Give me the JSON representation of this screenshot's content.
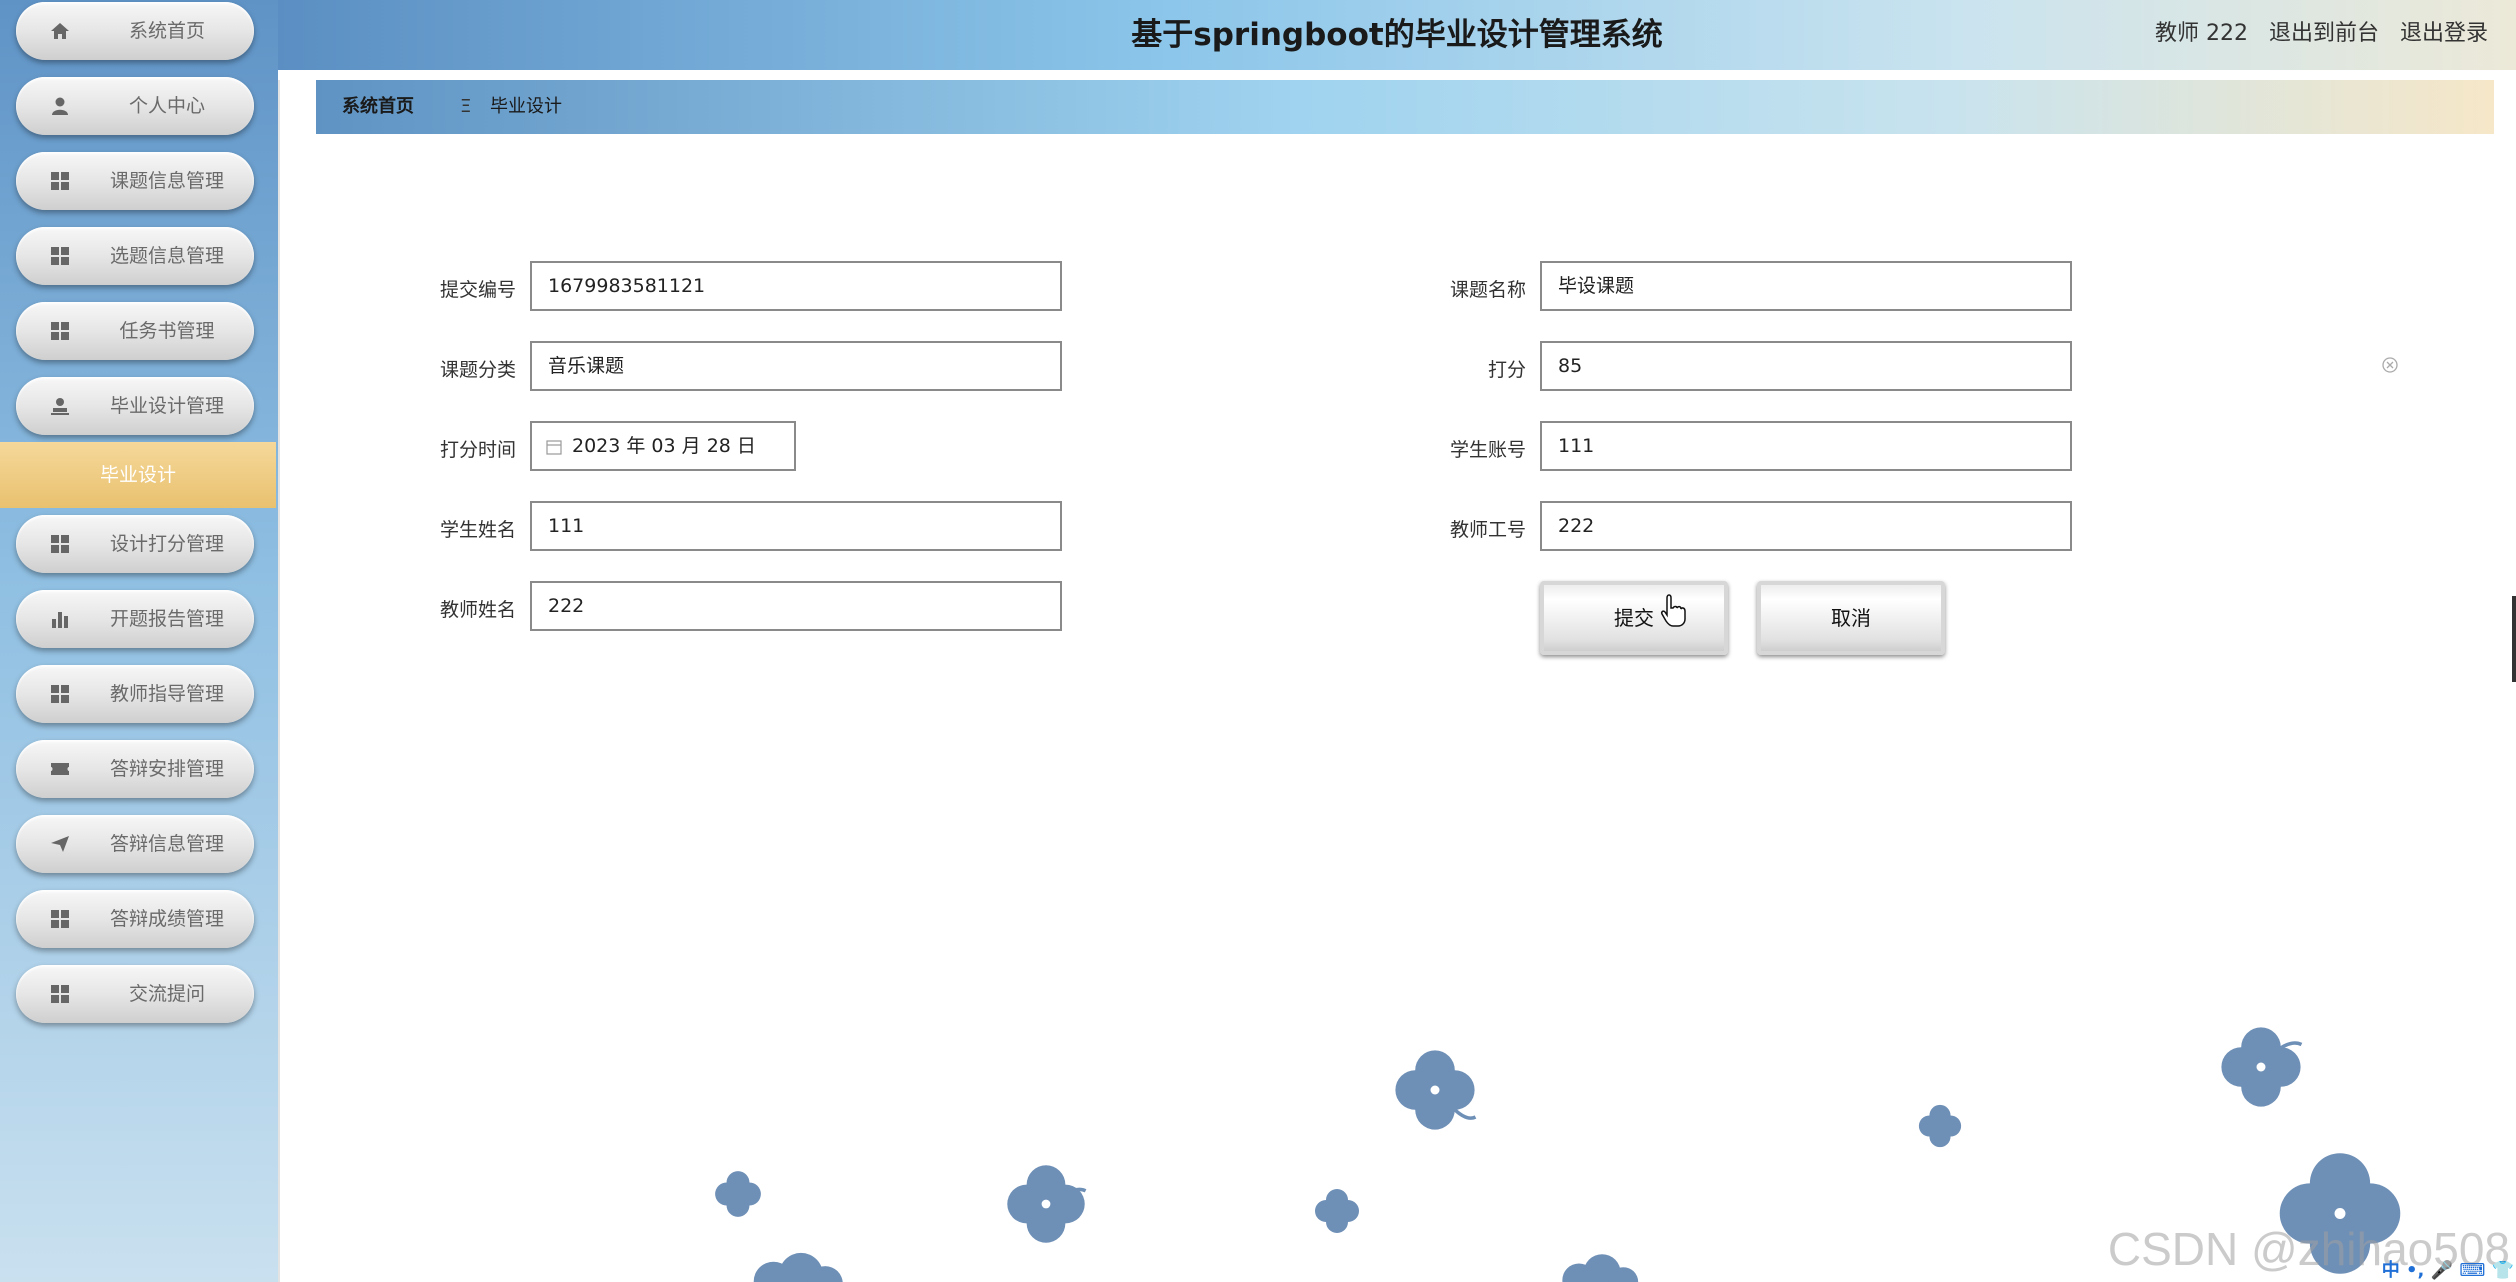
{
  "header": {
    "title": "基于springboot的毕业设计管理系统",
    "user": "教师 222",
    "to_front": "退出到前台",
    "logout": "退出登录"
  },
  "sidebar": {
    "items": [
      {
        "label": "系统首页",
        "icon": "home-icon"
      },
      {
        "label": "个人中心",
        "icon": "user-icon"
      },
      {
        "label": "课题信息管理",
        "icon": "grid-icon"
      },
      {
        "label": "选题信息管理",
        "icon": "grid-icon"
      },
      {
        "label": "任务书管理",
        "icon": "grid-icon"
      },
      {
        "label": "毕业设计管理",
        "icon": "user-stamp-icon"
      },
      {
        "label": "设计打分管理",
        "icon": "grid-icon"
      },
      {
        "label": "开题报告管理",
        "icon": "bar-chart-icon"
      },
      {
        "label": "教师指导管理",
        "icon": "grid-icon"
      },
      {
        "label": "答辩安排管理",
        "icon": "ticket-icon"
      },
      {
        "label": "答辩信息管理",
        "icon": "send-icon"
      },
      {
        "label": "答辩成绩管理",
        "icon": "grid-icon"
      },
      {
        "label": "交流提问",
        "icon": "grid-icon"
      }
    ],
    "sub_active": "毕业设计"
  },
  "breadcrumb": {
    "home": "系统首页",
    "sep": "Ξ",
    "current": "毕业设计"
  },
  "form": {
    "submit_no": {
      "label": "提交编号",
      "value": "1679983581121"
    },
    "topic_name": {
      "label": "课题名称",
      "value": "毕设课题"
    },
    "topic_category": {
      "label": "课题分类",
      "value": "音乐课题"
    },
    "score": {
      "label": "打分",
      "value": "85"
    },
    "score_time": {
      "label": "打分时间",
      "value": "2023 年 03 月 28 日"
    },
    "student_account": {
      "label": "学生账号",
      "value": "111"
    },
    "student_name": {
      "label": "学生姓名",
      "value": "111"
    },
    "teacher_no": {
      "label": "教师工号",
      "value": "222"
    },
    "teacher_name": {
      "label": "教师姓名",
      "value": "222"
    }
  },
  "buttons": {
    "submit": "提交",
    "cancel": "取消"
  },
  "watermark": "CSDN @zhihao508",
  "ime": "中 •, 🎤 ⌨ 👕",
  "colors": {
    "sidebar_top": "#5f93c6",
    "sub_active": "#e9c16f",
    "flower": "#6e8fb6"
  }
}
